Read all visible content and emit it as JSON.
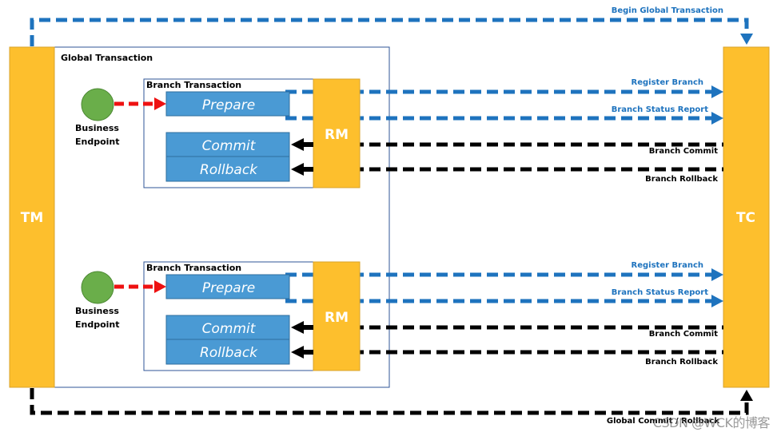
{
  "colors": {
    "tm_tc_fill": "#FDBF2D",
    "tm_tc_stroke": "#D9A32A",
    "blue_action": "#4A9AD4",
    "blue_action_stroke": "#2F6E9E",
    "blue_arrow": "#1E73BE",
    "black_arrow": "#000000",
    "red_arrow": "#EE1111",
    "endpoint_fill": "#6AAE4A",
    "frame_stroke": "#2F5597"
  },
  "tm": {
    "label": "TM"
  },
  "tc": {
    "label": "TC"
  },
  "global_transaction": {
    "label": "Global Transaction"
  },
  "begin_global": {
    "label": "Begin Global Transaction"
  },
  "global_commit": {
    "label": "Global Commit / Rollback"
  },
  "branches": [
    {
      "title": "Branch Transaction",
      "endpoint_label_1": "Business",
      "endpoint_label_2": "Endpoint",
      "prepare": "Prepare",
      "commit": "Commit",
      "rollback": "Rollback",
      "rm": "RM",
      "register": "Register Branch",
      "status_report": "Branch Status Report",
      "branch_commit": "Branch Commit",
      "branch_rollback": "Branch Rollback"
    },
    {
      "title": "Branch Transaction",
      "endpoint_label_1": "Business",
      "endpoint_label_2": "Endpoint",
      "prepare": "Prepare",
      "commit": "Commit",
      "rollback": "Rollback",
      "rm": "RM",
      "register": "Register Branch",
      "status_report": "Branch Status Report",
      "branch_commit": "Branch Commit",
      "branch_rollback": "Branch Rollback"
    }
  ],
  "watermark": "CSDN @WCK的博客"
}
